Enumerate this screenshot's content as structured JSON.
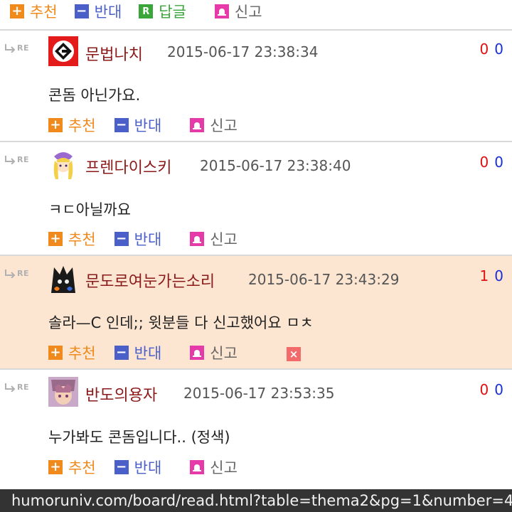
{
  "labels": {
    "recommend": "추천",
    "oppose": "반대",
    "reply": "답글",
    "report": "신고",
    "re": "RE"
  },
  "comments": [
    {
      "nick": "문법나치",
      "date": "2015-06-17 23:38:34",
      "up": "0",
      "down": "0",
      "body": "콘돔 아닌가요."
    },
    {
      "nick": "프렌다이스키",
      "date": "2015-06-17 23:38:40",
      "up": "0",
      "down": "0",
      "body": "ㅋㄷ아닐까요"
    },
    {
      "nick": "문도로여눈가는소리",
      "date": "2015-06-17 23:43:29",
      "up": "1",
      "down": "0",
      "body": "솔라—C 인데;; 윗분들 다 신고했어요 ㅁㅊ"
    },
    {
      "nick": "반도의용자",
      "date": "2015-06-17 23:53:35",
      "up": "0",
      "down": "0",
      "body": "누가봐도 콘돔입니다.. (정색)"
    }
  ],
  "url": "humoruniv.com/board/read.html?table=thema2&pg=1&number=4",
  "colors": {
    "recommend": "#f08a1c",
    "oppose": "#4b5fc9",
    "reply": "#3aa63a",
    "report": "#e53aa8",
    "nickname": "#8b1a1a",
    "highlight": "#fce6d2",
    "vote_up": "#e01010",
    "vote_down": "#1a2fd6"
  },
  "icons": [
    "plus-icon",
    "minus-icon",
    "reply-r-icon",
    "report-siren-icon",
    "reply-arrow-icon",
    "delete-x-icon"
  ]
}
